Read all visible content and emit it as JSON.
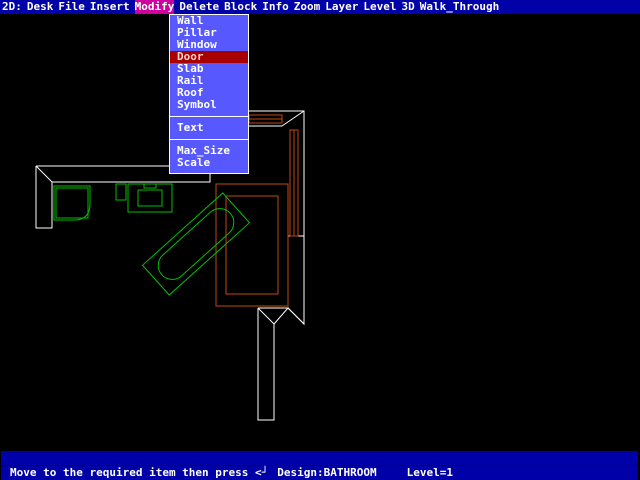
{
  "menubar": {
    "mode": "2D:",
    "items": [
      "Desk",
      "File",
      "Insert",
      "Modify",
      "Delete",
      "Block",
      "Info",
      "Zoom",
      "Layer",
      "Level",
      "3D",
      "Walk_Through"
    ],
    "selected_index": 3
  },
  "dropdown": {
    "group1": [
      "Wall",
      "Pillar",
      "Window",
      "Door",
      "Slab",
      "Rail",
      "Roof",
      "Symbol"
    ],
    "highlighted": "Door",
    "group2": [
      "Text"
    ],
    "group3": [
      "Max_Size",
      "Scale"
    ]
  },
  "status": {
    "message": "Move to the required item then press <┘",
    "design": "Design:BATHROOM",
    "level": "Level=1"
  },
  "colors": {
    "background": "#000000",
    "menu_bg": "#0000a8",
    "dropdown_bg": "#5858ff",
    "selected": "#d000a0",
    "walls": "#ffffff",
    "fixtures": "#00c000",
    "bath": "#c04810"
  }
}
